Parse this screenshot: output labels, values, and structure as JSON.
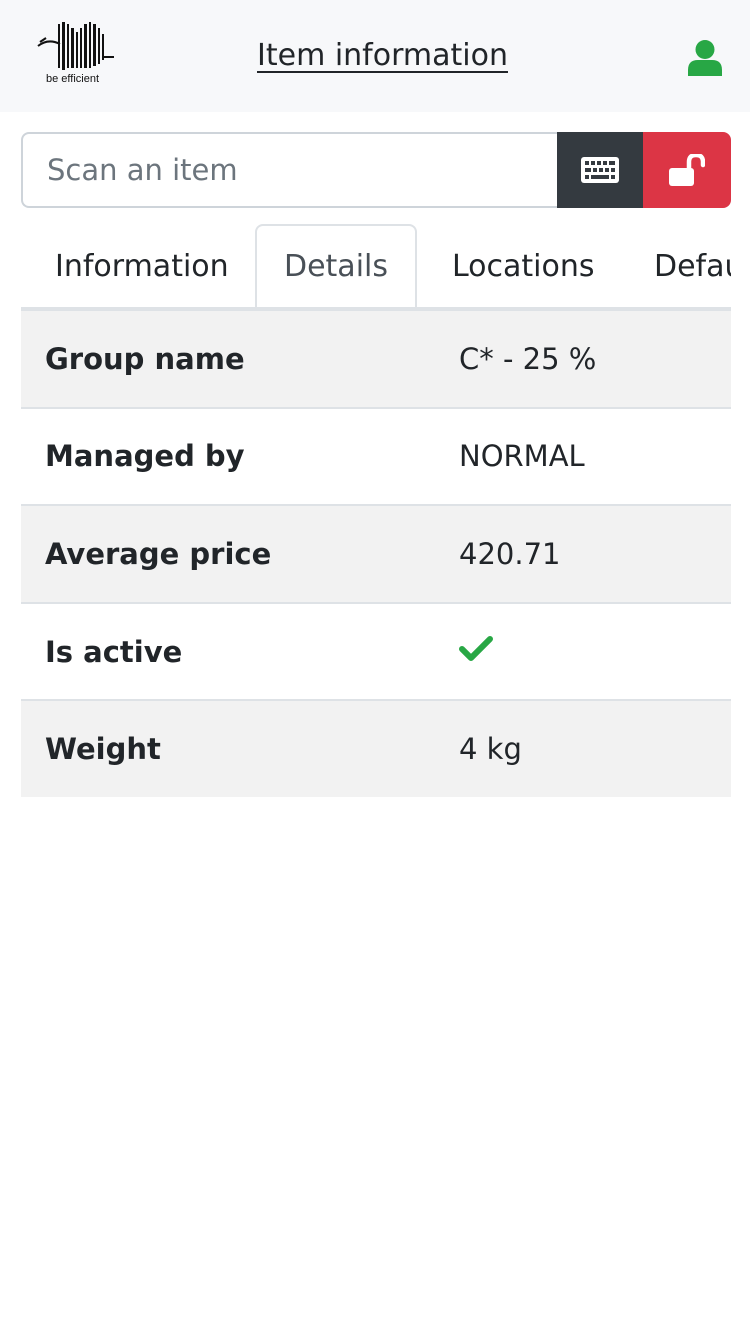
{
  "header": {
    "logo_text": "be efficient",
    "title": "Item information",
    "user_icon": "user-icon",
    "user_icon_color": "#28a745"
  },
  "scan": {
    "placeholder": "Scan an item",
    "value": "",
    "keyboard_icon": "keyboard-icon",
    "lock_icon": "unlock-icon",
    "keyboard_button_color": "#343a40",
    "lock_button_color": "#dc3545"
  },
  "tabs": [
    {
      "label": "Information",
      "active": false
    },
    {
      "label": "Details",
      "active": true
    },
    {
      "label": "Locations",
      "active": false
    },
    {
      "label": "Defau",
      "active": false
    }
  ],
  "details": [
    {
      "label": "Group name",
      "value": "C* - 25 %"
    },
    {
      "label": "Managed by",
      "value": "NORMAL"
    },
    {
      "label": "Average price",
      "value": "420.71"
    },
    {
      "label": "Is active",
      "value": null,
      "icon": "check-icon",
      "icon_color": "#28a745"
    },
    {
      "label": "Weight",
      "value": "4 kg"
    }
  ]
}
